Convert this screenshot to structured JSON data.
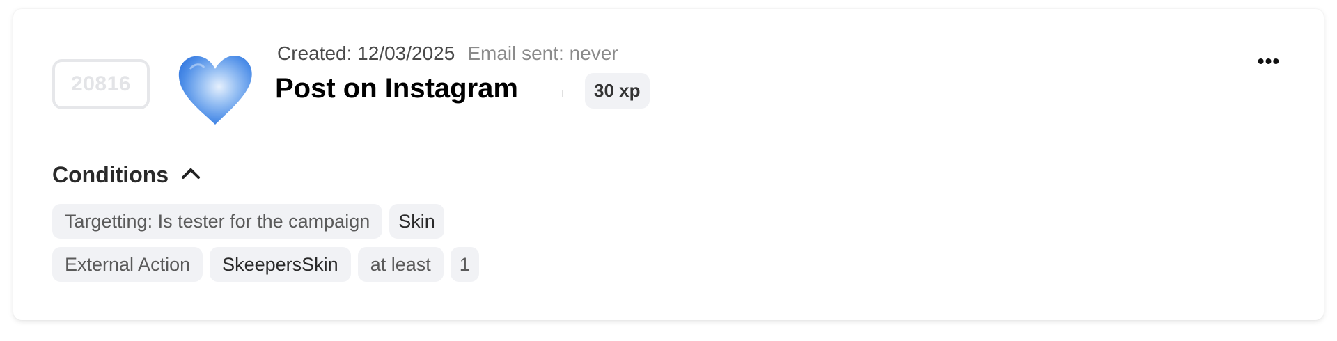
{
  "reward": {
    "id": "20816",
    "created_label": "Created: 12/03/2025",
    "email_sent_label": "Email sent: never",
    "title": "Post on Instagram",
    "xp": "30 xp",
    "more_label": "•••",
    "icon": "blue-watercolor-heart-icon"
  },
  "conditions": {
    "header": "Conditions",
    "toggle_icon": "chevron-up-icon",
    "rows": [
      {
        "chips": [
          {
            "label": "Targetting: Is tester for the campaign"
          },
          {
            "label": "Skin"
          }
        ]
      },
      {
        "chips": [
          {
            "label": "External Action"
          },
          {
            "label": "SkeepersSkin"
          },
          {
            "label": "at least"
          },
          {
            "label": "1"
          }
        ]
      }
    ]
  },
  "colors": {
    "chip_bg": "#f1f2f5",
    "heart_blue": "#3f86e6",
    "badge_border": "#e6e7ea"
  }
}
